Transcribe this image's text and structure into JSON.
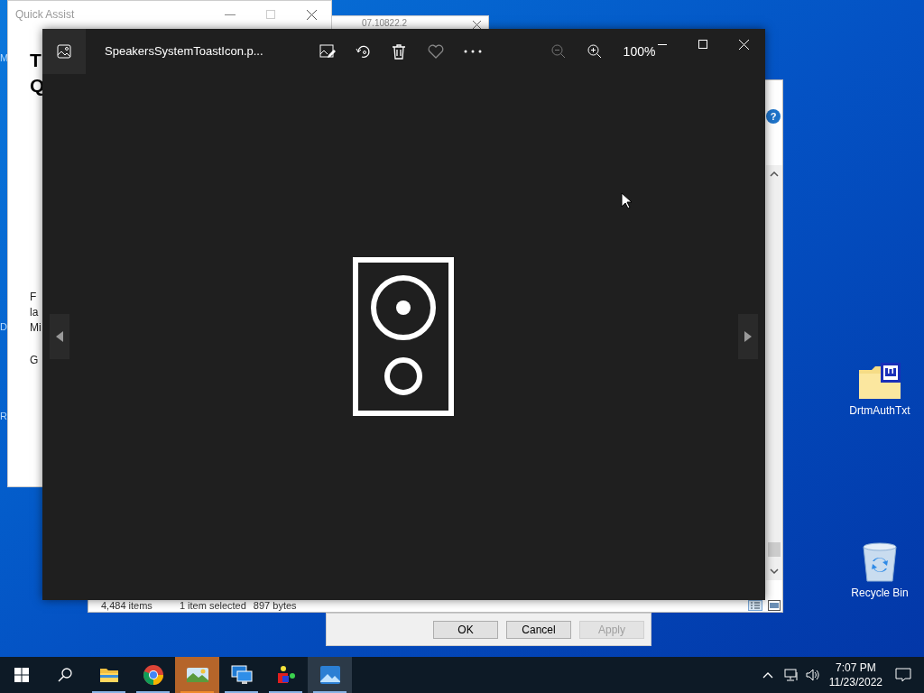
{
  "desktop": {
    "edge_labels": [
      "M",
      "D",
      "R"
    ],
    "icons": [
      {
        "kind": "folder",
        "label": "DrtmAuthTxt"
      },
      {
        "kind": "recycle",
        "label": "Recycle Bin"
      }
    ]
  },
  "quick_assist": {
    "title": "Quick Assist",
    "heading": [
      "T",
      "Q"
    ],
    "paragraph": [
      "F",
      "la",
      "Mi"
    ],
    "link": "G"
  },
  "back_window": {
    "title": "07.10822.2"
  },
  "explorer": {
    "help": "?",
    "item_count": "4,484 items",
    "selection": "1 item selected",
    "size": "897 bytes"
  },
  "properties_dialog": {
    "buttons": [
      {
        "label": "OK",
        "disabled": false
      },
      {
        "label": "Cancel",
        "disabled": false
      },
      {
        "label": "Apply",
        "disabled": true
      }
    ]
  },
  "photos": {
    "file_name": "SpeakersSystemToastIcon.p...",
    "zoom": "100%",
    "zoom_out_disabled": true,
    "favorite": false
  },
  "taskbar": {
    "apps": [
      {
        "kind": "explorer",
        "selected": false,
        "flashing": false
      },
      {
        "kind": "chrome",
        "selected": false,
        "flashing": false
      },
      {
        "kind": "landscape",
        "selected": false,
        "flashing": true
      },
      {
        "kind": "remote",
        "selected": false,
        "flashing": false
      },
      {
        "kind": "shapes",
        "selected": false,
        "flashing": false
      },
      {
        "kind": "photos",
        "selected": true,
        "flashing": false
      }
    ],
    "time": "7:07 PM",
    "date": "11/23/2022"
  }
}
